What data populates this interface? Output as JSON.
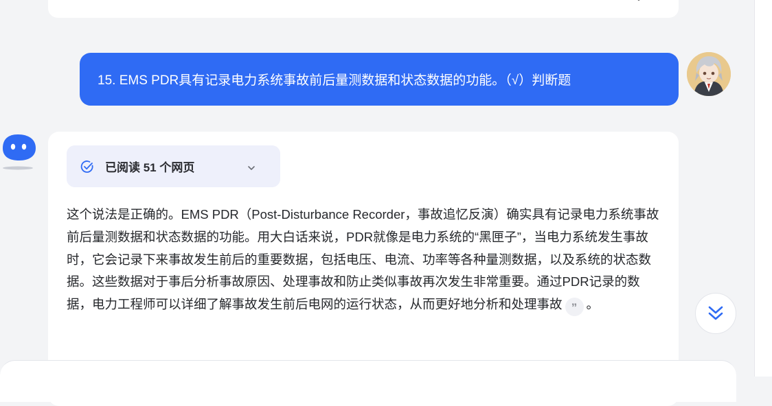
{
  "user_message": {
    "text": "15. EMS PDR具有记录电力系统事故前后量测数据和状态数据的功能。（√）判断题"
  },
  "answer": {
    "sources_label": "已阅读 51 个网页",
    "body": "这个说法是正确的。EMS PDR（Post-Disturbance Recorder，事故追忆反演）确实具有记录电力系统事故前后量测数据和状态数据的功能。用大白话来说，PDR就像是电力系统的“黑匣子”，当电力系统发生事故时，它会记录下来事故发生前后的重要数据，包括电压、电流、功率等各种量测数据，以及系统的状态数据。这些数据对于事后分析事故原因、处理事故和防止类似事故再次发生非常重要。通过PDR记录的数据，电力工程师可以详细了解事故发生前后电网的运行状态，从而更好地分析和处理事故",
    "quote_glyph": "”",
    "trailing": "。"
  },
  "icons": {
    "check": "check-circle-icon",
    "chevron": "chevron-down-icon",
    "scroll": "double-chevron-down-icon",
    "quote": "quote-icon"
  },
  "colors": {
    "accent": "#2f6bf4",
    "background": "#f3f4f6",
    "card": "#ffffff",
    "pill": "#eef0fb"
  }
}
